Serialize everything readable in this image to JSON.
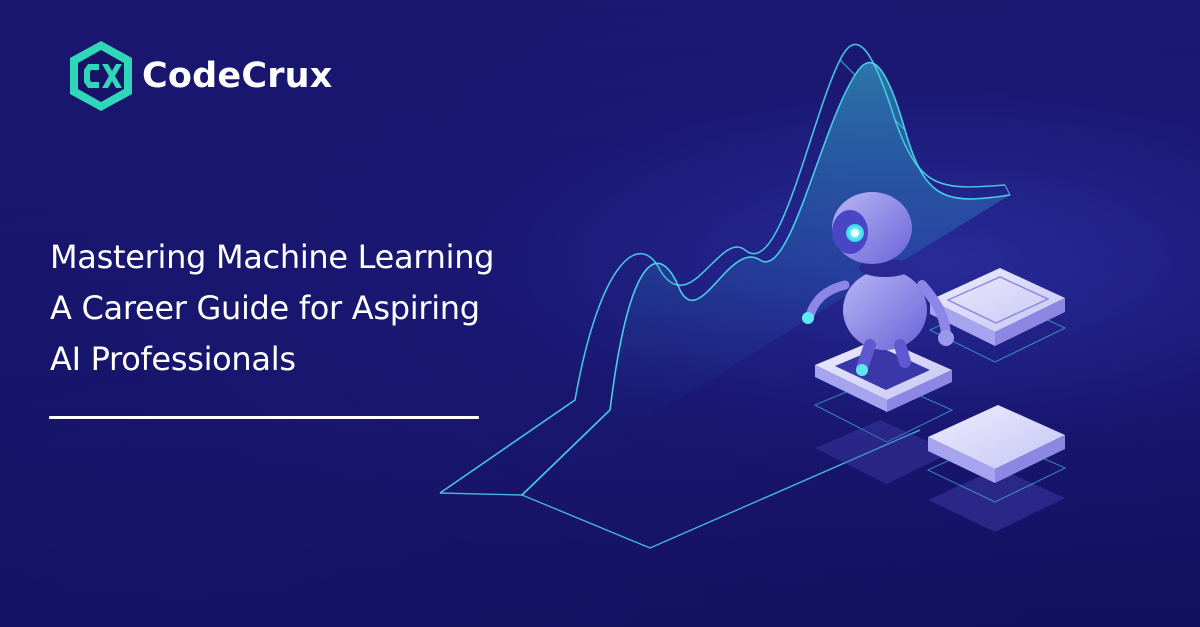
{
  "brand": {
    "name": "CodeCrux",
    "logo_icon": "cx-hexagon-logo-icon",
    "logo_color": "#2fd6b8"
  },
  "headline": {
    "lines": [
      "Mastering Machine Learning",
      "A Career Guide for Aspiring",
      "AI Professionals"
    ]
  },
  "illustration": {
    "icon": "robot-with-data-wave-illustration",
    "accent_color": "#4ee0f0"
  },
  "colors": {
    "background": "#171466",
    "text": "#ffffff"
  }
}
